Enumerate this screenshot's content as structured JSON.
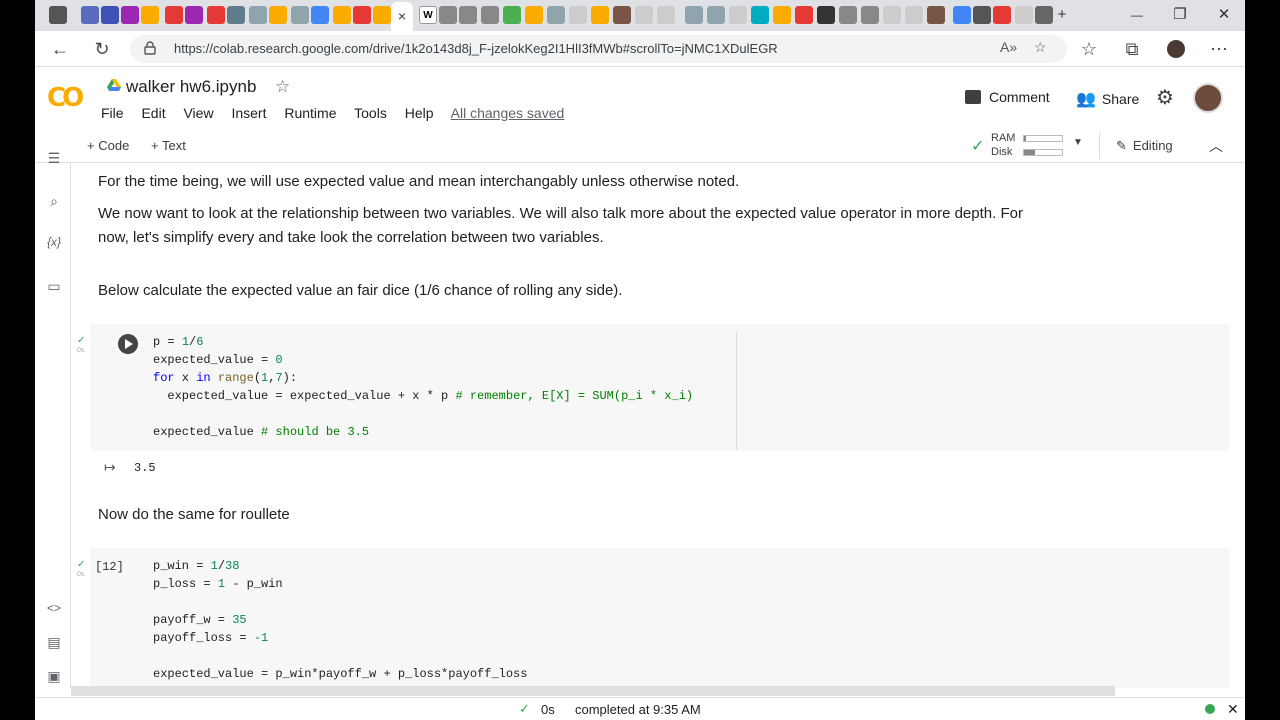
{
  "browser": {
    "url": "https://colab.research.google.com/drive/1k2o143d8j_F-jzelokKeg2I1HlI3fMWb#scrollTo=jNMC1XDulEGR",
    "active_tab_close": "×",
    "new_tab": "+",
    "win_minimize": "—",
    "win_restore": "❐",
    "win_close": "✕"
  },
  "colab": {
    "title": "walker hw6.ipynb",
    "menu": [
      "File",
      "Edit",
      "View",
      "Insert",
      "Runtime",
      "Tools",
      "Help"
    ],
    "saved_status": "All changes saved",
    "comment_label": "Comment",
    "share_label": "Share",
    "add_code_label": "Code",
    "add_text_label": "Text",
    "ram_label": "RAM",
    "disk_label": "Disk",
    "ram_level": 0.05,
    "disk_level": 0.3,
    "editing_label": "Editing"
  },
  "markdown": {
    "p1": "For the time being, we will use expected value and mean interchangably unless otherwise noted.",
    "p2a": "We now want to look at the relationship between two variables. We will also talk more about the expected value operator in more depth. For",
    "p2b": "now, let's simplify every and take look the correlation between two variables.",
    "p3": "Below calculate the expected value an fair dice (1/6 chance of rolling any side).",
    "p4": "Now do the same for roullete"
  },
  "cell1": {
    "exec_time": "0s",
    "output": "3.5"
  },
  "cell2": {
    "exec_count": "[12]",
    "exec_time": "0s"
  },
  "status": {
    "time": "0s",
    "message": "completed at 9:35 AM"
  },
  "colors": {
    "accent_green": "#34a853",
    "colab_orange": "#f9ab00"
  }
}
